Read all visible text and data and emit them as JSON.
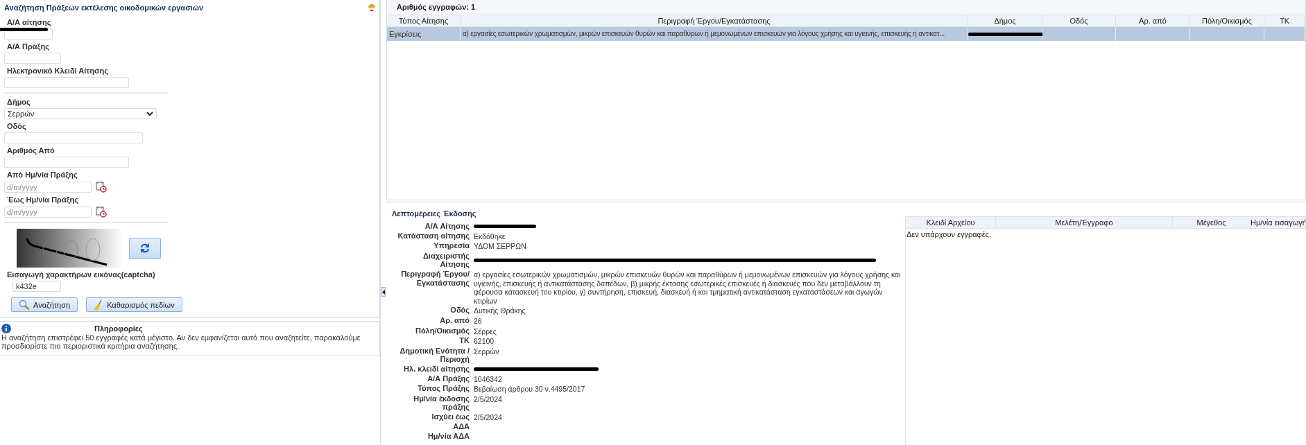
{
  "search_panel": {
    "title": "Αναζήτηση Πράξεων εκτέλεσης οικοδομικών εργασιών",
    "fields": [
      {
        "kind": "text",
        "label": "Α/Α αίτησης",
        "redacted": true
      },
      {
        "kind": "text",
        "label": "Α/Α Πράξης"
      },
      {
        "kind": "text",
        "label": "Ηλεκτρονικό Κλειδί Αίτησης"
      },
      {
        "kind": "divider"
      },
      {
        "kind": "select",
        "label": "Δήμος",
        "value": "Σερρών"
      },
      {
        "kind": "text",
        "label": "Οδός"
      },
      {
        "kind": "text",
        "label": "Αριθμός Από"
      },
      {
        "kind": "date",
        "label": "Από Ημ/νία Πράξης",
        "placeholder": "d/m/yyyy"
      },
      {
        "kind": "date",
        "label": "Έως Ημ/νία Πράξης",
        "placeholder": "d/m/yyyy"
      },
      {
        "kind": "divider"
      }
    ],
    "captcha": {
      "label": "Εισαγωγή χαρακτήρων εικόνας(captcha)",
      "value": "k432e"
    },
    "buttons": [
      {
        "kind": "search",
        "label": "Αναζήτηση"
      },
      {
        "kind": "clear",
        "label": "Καθαρισμός πεδίων"
      }
    ]
  },
  "info": {
    "title": "Πληροφορίες",
    "text": "Η αναζήτηση επιστρέφει 50 εγγραφές κατά μέγιστο. Αν δεν εμφανίζεται αυτό που αναζητείτε, παρακαλούμε προσδιορίστε πιο περιοριστικά κριτήρια αναζήτησης."
  },
  "results": {
    "count": "Αριθμός εγγραφών: 1",
    "columns": [
      "Τύπος Αίτησης",
      "Περιγραφή Έργου/Εγκατάστασης",
      "Δήμος",
      "Οδός",
      "Αρ. από",
      "Πόλη/Οικισμός",
      "ΤΚ"
    ],
    "rows": [
      {
        "selected": true,
        "redacted": true,
        "cells": [
          "Εγκρίσεις",
          "α) εργασίες εσωτερικών χρωματισμών, μικρών επισκευών θυρών και παραθύρων ή μεμονωμένων επισκευών για λόγους χρήσης και υγιεινής, επισκευής ή αντικατ..."
        ]
      }
    ]
  },
  "details": {
    "title": "Λεπτομέρειες Έκδοσης",
    "rows": [
      {
        "label": "Α/Α Αίτησης",
        "redacted": true
      },
      {
        "label": "Κατάσταση αίτησης",
        "value": "Εκδόθηκε"
      },
      {
        "label": "Υπηρεσία",
        "value": "ΥΔΟΜ ΣΕΡΡΩΝ"
      },
      {
        "label": "Διαχειριστής Αίτησης",
        "redacted": true
      },
      {
        "label": "Περιγραφή Έργου/ Εγκατάστασης",
        "value": "α) εργασίες εσωτερικών χρωματισμών, μικρών επισκευών θυρών και παραθύρων ή μεμονωμένων επισκευών για λόγους χρήσης και υγιεινής, επισκευής ή αντικατάστασης δαπέδων, β) μικρής έκτασης εσωτερικές επισκευές ή διασκευές που δεν μεταβάλλουν τη φέρουσα κατασκευή του κτιρίου, γ) συντήρηση, επισκευή, διασκευή ή και τμηματική αντικατάσταση εγκαταστάσεων και αγωγών κτιρίων"
      },
      {
        "label": "Οδός",
        "value": "Δυτικής Θράκης"
      },
      {
        "label": "Αρ. από",
        "value": "26"
      },
      {
        "label": "Πόλη/Οικισμός",
        "value": "Σέρρες"
      },
      {
        "label": "ΤΚ",
        "value": "62100"
      },
      {
        "label": "Δημοτική Ενότητα / Περιοχή",
        "value": "Σερρών"
      },
      {
        "label": "Ηλ. κλειδί αίτησης",
        "redacted": true
      },
      {
        "label": "Α/Α Πράξης",
        "value": "1046342"
      },
      {
        "label": "Τύπος Πράξης",
        "value": "Βεβαίωση άρθρου 30 ν.4495/2017"
      },
      {
        "label": "Ημ/νία έκδοσης πράξης",
        "value": "2/5/2024"
      },
      {
        "label": "Ισχύει έως",
        "value": "2/5/2024"
      },
      {
        "label": "ΑΔΑ"
      },
      {
        "label": "Ημ/νία ΑΔΑ"
      }
    ]
  },
  "files": {
    "columns": [
      "Κλειδί Αρχείου",
      "Μελέτη/Έγγραφο",
      "Μέγεθος",
      "Ημ/νία εισαγωγή"
    ],
    "empty": "Δεν υπάρχουν εγγραφές."
  }
}
